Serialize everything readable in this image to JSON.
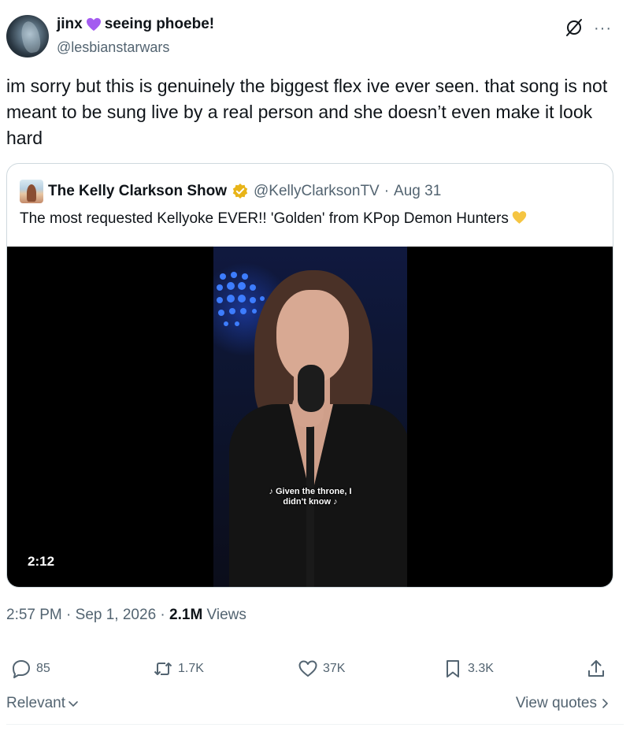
{
  "tweet": {
    "author_name_part1": "jinx",
    "author_name_part2": "seeing phoebe!",
    "author_handle": "@lesbianstarwars",
    "text": "im sorry but this is genuinely the biggest flex ive ever seen. that song is not meant to be sung live by a real person and she doesn’t even make it look hard",
    "heart_color": "#a45cf0"
  },
  "quote": {
    "name": "The Kelly Clarkson Show",
    "handle": "@KellyClarksonTV",
    "separator": "·",
    "date": "Aug 31",
    "text": "The most requested Kellyoke EVER!! 'Golden' from KPop Demon Hunters",
    "verified_color": "#e8b418",
    "heart_color": "#f5c542"
  },
  "video": {
    "subtitle_line1": "♪ Given the throne, I",
    "subtitle_line2": "didn't know ♪",
    "duration": "2:12"
  },
  "meta": {
    "time": "2:57 PM",
    "sep1": " · ",
    "date": "Sep 1, 2026",
    "sep2": " · ",
    "views_count": "2.1M",
    "views_label": " Views"
  },
  "actions": {
    "replies": "85",
    "reposts": "1.7K",
    "likes": "37K",
    "bookmarks": "3.3K"
  },
  "footer": {
    "sort_label": "Relevant",
    "view_quotes_label": "View quotes"
  },
  "icons": {
    "grok": "grok-icon",
    "more": "more-icon",
    "reply": "reply-icon",
    "repost": "repost-icon",
    "like": "heart-icon",
    "bookmark": "bookmark-icon",
    "share": "share-icon"
  }
}
